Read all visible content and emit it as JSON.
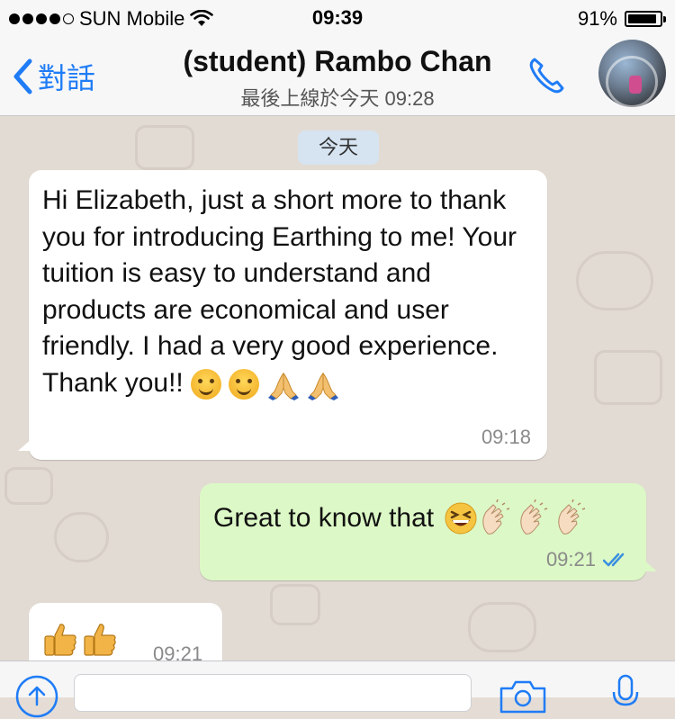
{
  "status_bar": {
    "carrier": "SUN Mobile",
    "time": "09:39",
    "battery": "91%",
    "battery_level": 0.91,
    "signal_bars": 4
  },
  "nav": {
    "back_label": "對話",
    "title": "(student) Rambo Chan",
    "subtitle": "最後上線於今天 09:28",
    "call_icon": "phone-icon",
    "avatar_icon": "contact-avatar"
  },
  "chat": {
    "date_chip": "今天",
    "messages": [
      {
        "direction": "in",
        "text": "Hi Elizabeth, just a short more to thank you for introducing Earthing to me! Your tuition is easy to understand and products are economical and user friendly.   I had a very good experience.  Thank you!!",
        "emojis": [
          "smiling-face",
          "smiling-face",
          "folded-hands",
          "folded-hands"
        ],
        "time": "09:18"
      },
      {
        "direction": "out",
        "text": "Great to know that",
        "emojis": [
          "grinning-squinting-face",
          "clapping-hands",
          "clapping-hands",
          "clapping-hands"
        ],
        "time": "09:21",
        "status": "read"
      },
      {
        "direction": "in",
        "text": "",
        "emojis": [
          "thumbs-up",
          "thumbs-up"
        ],
        "time": "09:21"
      }
    ]
  },
  "input": {
    "plus_icon": "add-attachment-icon",
    "camera_icon": "camera-icon",
    "mic_icon": "microphone-icon"
  },
  "colors": {
    "accent": "#1f7cf6",
    "incoming_bubble": "#ffffff",
    "outgoing_bubble": "#dcf8c6",
    "chat_background": "#e2dbd3",
    "read_ticks": "#3a8fe0"
  }
}
